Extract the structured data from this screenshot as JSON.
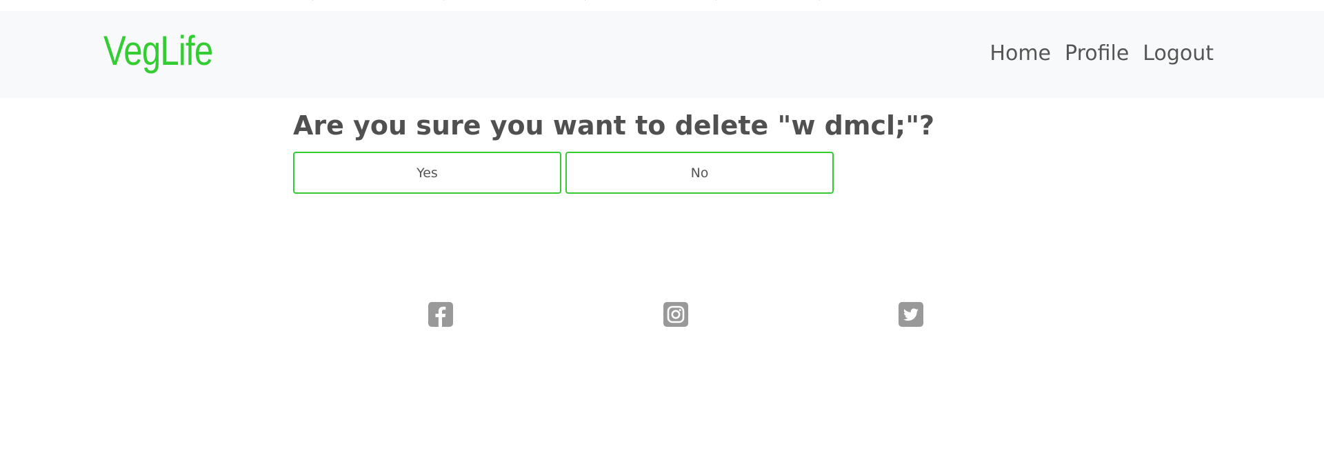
{
  "navbar": {
    "brand": "VegLife",
    "links": [
      "Home",
      "Profile",
      "Logout"
    ]
  },
  "confirm": {
    "question": "Are you sure you want to delete \"w dmcl;\"?",
    "yes_label": "Yes",
    "no_label": "No"
  },
  "footer": {
    "icons": [
      "facebook-icon",
      "instagram-icon",
      "twitter-icon"
    ]
  },
  "colors": {
    "brand": "#33cc33",
    "navbar_bg": "#f8f9fa",
    "text": "#555555",
    "icon": "#999999"
  }
}
